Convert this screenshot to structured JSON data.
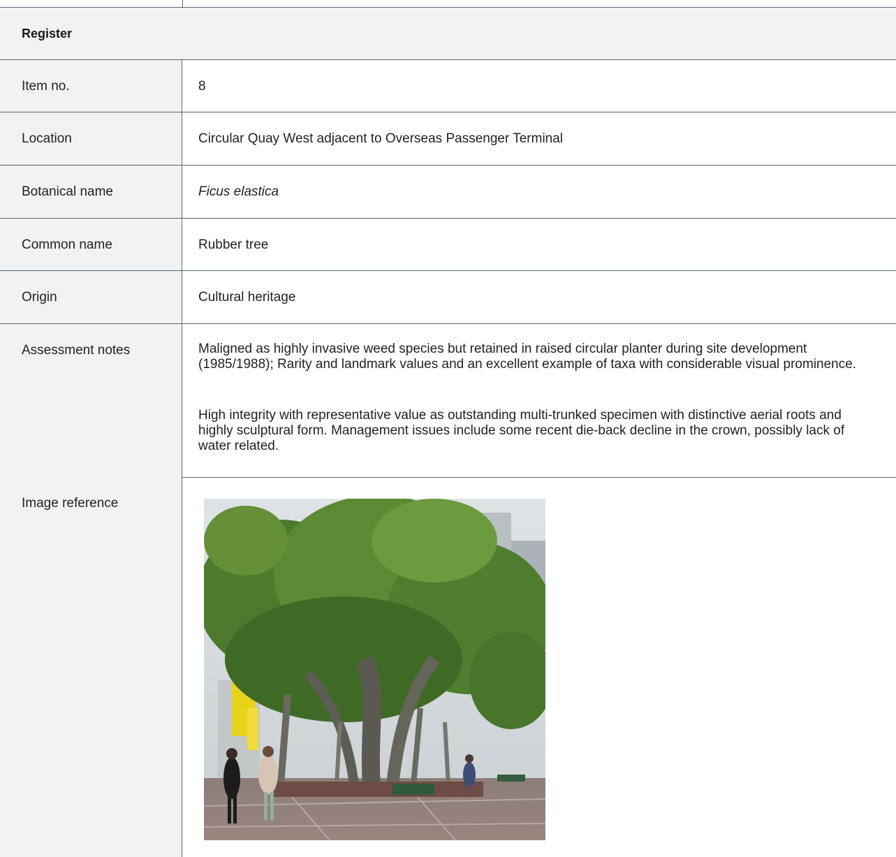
{
  "header": {
    "title": "Register"
  },
  "rows": [
    {
      "label": "Item no.",
      "value": "8"
    },
    {
      "label": "Location",
      "value": "Circular Quay West adjacent to Overseas Passenger Terminal"
    },
    {
      "label": "Botanical name",
      "value": "Ficus elastica"
    },
    {
      "label": "Common name",
      "value": "Rubber tree"
    },
    {
      "label": "Origin",
      "value": "Cultural heritage"
    }
  ],
  "assessment": {
    "label": "Assessment notes",
    "para1": "Maligned as highly invasive weed species but retained in raised circular planter during site development (1985/1988); Rarity and landmark values and an excellent example of taxa with considerable visual prominence.",
    "para2": "High integrity with representative value as outstanding multi-trunked specimen with distinctive aerial roots and highly sculptural form. Management issues include some recent die-back decline in the crown, possibly lack of water related."
  },
  "image_reference": {
    "label": "Image reference"
  },
  "colors": {
    "label_bg": "#f2f2f2",
    "rule": "#5a6470",
    "text": "#231f20"
  }
}
